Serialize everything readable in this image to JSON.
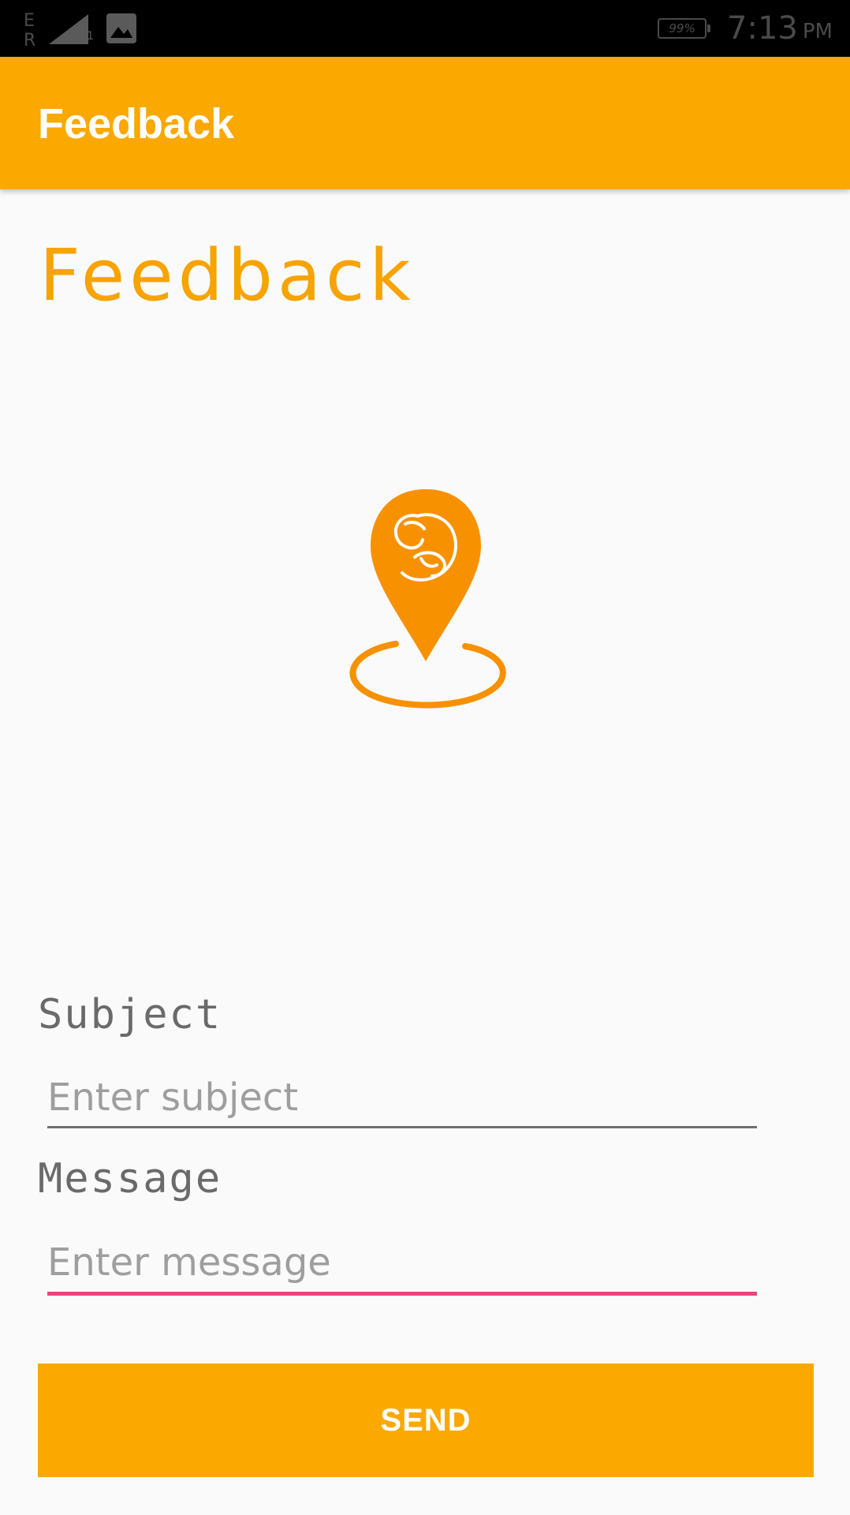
{
  "status_bar": {
    "network_type": "E R",
    "sim_slot": "1",
    "battery_percent": "99%",
    "time": "7:13",
    "ampm": "PM",
    "icons": [
      "signal-icon",
      "image-notification-icon",
      "battery-icon"
    ]
  },
  "app_bar": {
    "title": "Feedback"
  },
  "page": {
    "heading": "Feedback"
  },
  "form": {
    "subject_label": "Subject",
    "subject_placeholder": "Enter subject",
    "subject_value": "",
    "message_label": "Message",
    "message_placeholder": "Enter message",
    "message_value": "",
    "send_label": "SEND"
  },
  "colors": {
    "accent": "#FBA800",
    "heading": "#F7A300",
    "logo": "#F79100",
    "focused_underline": "#E8457A",
    "background": "#fafafa"
  }
}
